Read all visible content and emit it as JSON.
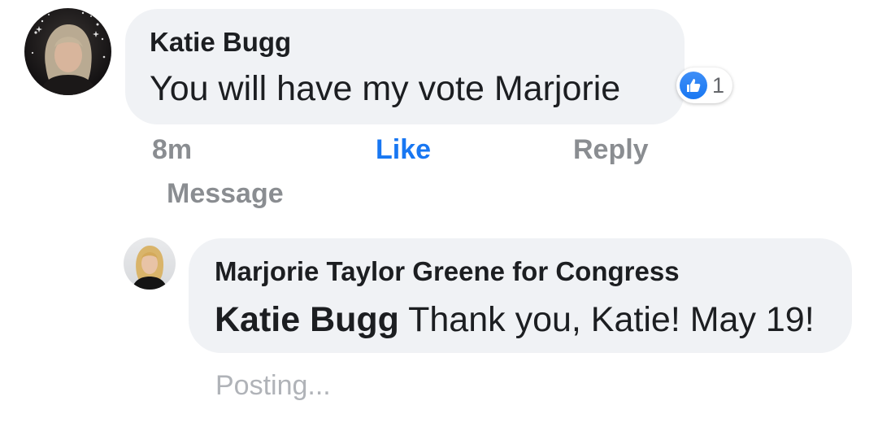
{
  "comment": {
    "author": "Katie Bugg",
    "text": "You will have my vote Marjorie",
    "reaction": {
      "icon": "thumbs-up-icon",
      "count": "1",
      "color": "#1877f2"
    },
    "timestamp": "8m",
    "like_label": "Like",
    "reply_label": "Reply",
    "message_label": "Message"
  },
  "reply": {
    "author": "Marjorie Taylor Greene for Congress",
    "mention": "Katie Bugg",
    "text": "Thank you, Katie! May 19!",
    "status": "Posting..."
  },
  "colors": {
    "bubble": "#f0f2f5",
    "text": "#1c1e21",
    "muted": "#8a8d91",
    "link": "#1877f2"
  }
}
